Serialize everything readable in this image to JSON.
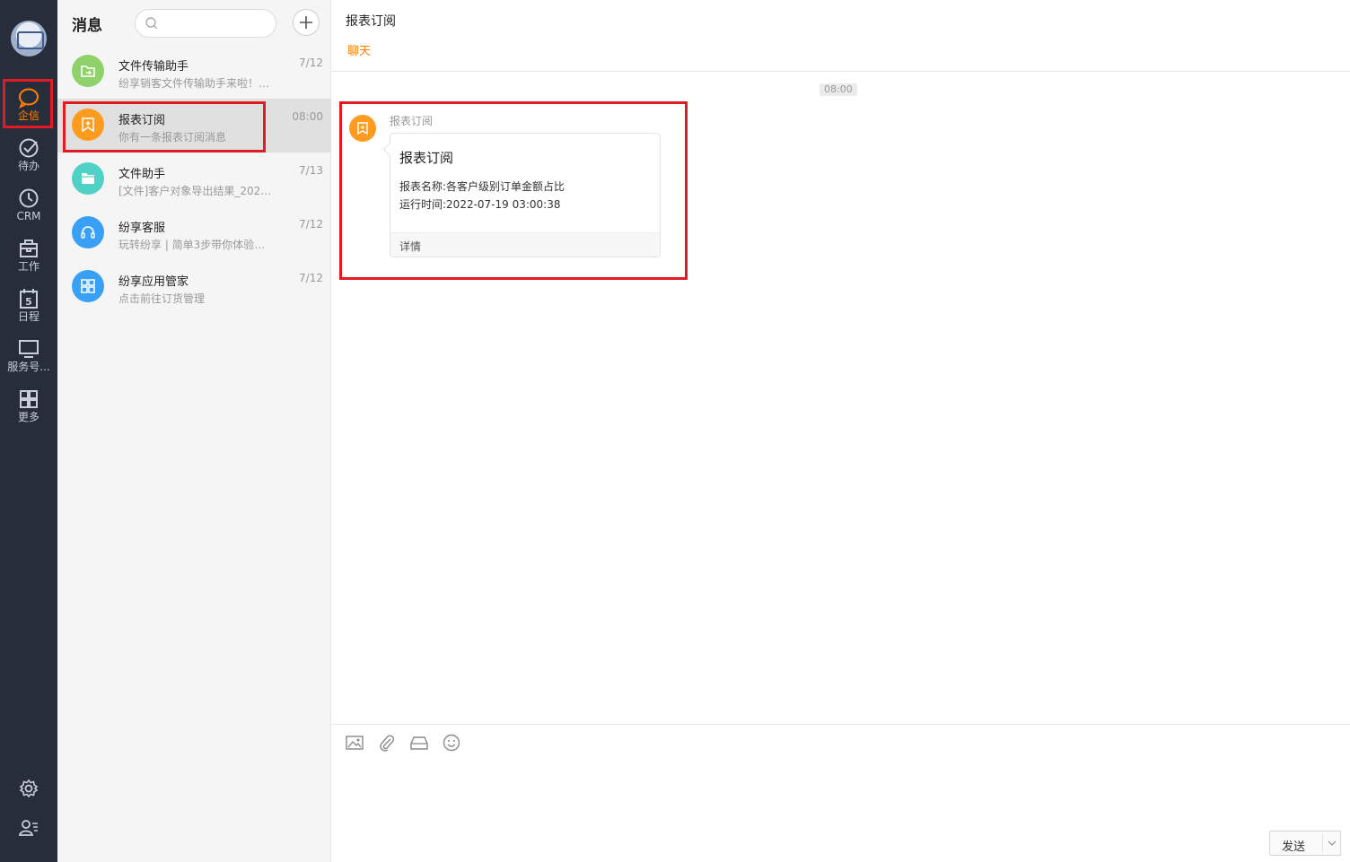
{
  "nav": {
    "items": [
      {
        "label": "企信",
        "icon": "chat-bubble-icon",
        "active": true
      },
      {
        "label": "待办",
        "icon": "check-circle-icon"
      },
      {
        "label": "CRM",
        "icon": "clock-icon"
      },
      {
        "label": "工作",
        "icon": "briefcase-icon"
      },
      {
        "label": "日程",
        "icon": "calendar-icon",
        "calendar_day": "5"
      },
      {
        "label": "服务号...",
        "icon": "monitor-icon"
      },
      {
        "label": "更多",
        "icon": "grid-icon"
      }
    ],
    "bottom": [
      "settings-gear-icon",
      "contacts-person-icon"
    ]
  },
  "list": {
    "title": "消息",
    "search_placeholder": "",
    "conversations": [
      {
        "name": "文件传输助手",
        "preview": "纷享销客文件传输助手来啦！…",
        "time": "7/12",
        "color": "#8fd16a",
        "icon": "file-transfer-icon"
      },
      {
        "name": "报表订阅",
        "preview": "你有一条报表订阅消息",
        "time": "08:00",
        "color": "#ff9b1f",
        "icon": "report-bookmark-icon",
        "selected": true
      },
      {
        "name": "文件助手",
        "preview": "[文件]客户对象导出结果_202…",
        "time": "7/13",
        "color": "#4fd1c5",
        "icon": "folder-icon"
      },
      {
        "name": "纷享客服",
        "preview": "玩转纷享 | 简单3步带你体验…",
        "time": "7/12",
        "color": "#3aa0f5",
        "icon": "headset-icon"
      },
      {
        "name": "纷享应用管家",
        "preview": "点击前往订货管理",
        "time": "7/12",
        "color": "#3aa0f5",
        "icon": "apps-grid-icon"
      }
    ]
  },
  "chat": {
    "title": "报表订阅",
    "tab": "聊天",
    "time_divider": "08:00",
    "message": {
      "sender": "报表订阅",
      "card_title": "报表订阅",
      "report_name": "报表名称:各客户级别订单金额占比",
      "run_time": "运行时间:2022-07-19 03:00:38",
      "detail": "详情"
    },
    "toolbar": [
      "image-icon",
      "attachment-icon",
      "disk-icon",
      "emoji-icon"
    ],
    "send_label": "发送"
  },
  "colors": {
    "accent": "#ff8000",
    "highlight": "#e21a22",
    "nav_bg": "#272d3a"
  }
}
